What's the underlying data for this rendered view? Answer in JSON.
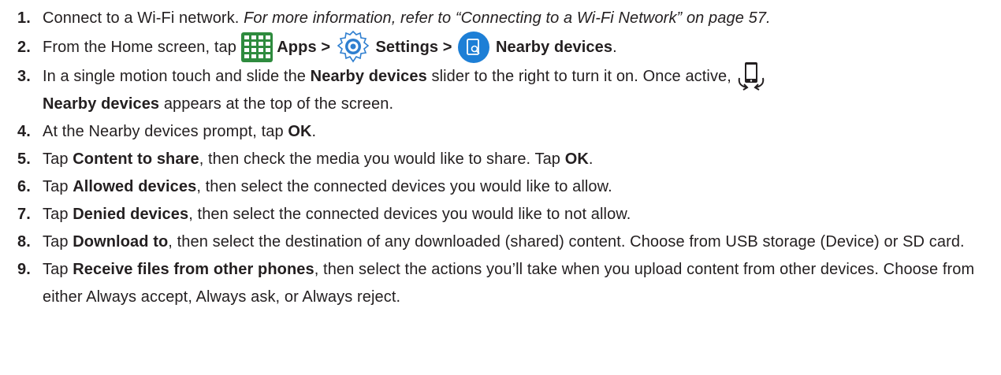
{
  "steps": [
    {
      "num": "1.",
      "text": "Connect to a Wi-Fi network. ",
      "note": "For more information, refer to “Connecting to a Wi-Fi Network” on page 57."
    },
    {
      "num": "2.",
      "pre": "From the Home screen, tap ",
      "apps": "Apps >",
      "settings": "Settings >",
      "nearby": "Nearby devices",
      "end": "."
    },
    {
      "num": "3.",
      "pre": "In a single motion touch and slide the ",
      "bold1": "Nearby devices",
      "mid": " slider to the right to turn it on. Once active,",
      "bold2": "Nearby devices",
      "post": " appears at the top of the screen."
    },
    {
      "num": "4.",
      "pre": "At the Nearby devices prompt, tap ",
      "bold": "OK",
      "post": "."
    },
    {
      "num": "5.",
      "pre": "Tap ",
      "bold": "Content to share",
      "mid": ", then check the media you would like to share. Tap ",
      "bold2": "OK",
      "post": "."
    },
    {
      "num": "6.",
      "pre": "Tap ",
      "bold": "Allowed devices",
      "post": ", then select the connected devices you would like to allow."
    },
    {
      "num": "7.",
      "pre": "Tap ",
      "bold": "Denied devices",
      "post": ", then select the connected devices you would like to not allow."
    },
    {
      "num": "8.",
      "pre": "Tap ",
      "bold": "Download to",
      "post": ", then select the destination of any downloaded (shared) content. Choose from USB storage (Device) or SD card."
    },
    {
      "num": "9.",
      "pre": "Tap ",
      "bold": "Receive files from other phones",
      "post": ", then select the actions you’ll take when you upload content from other devices. Choose from either Always accept, Always ask, or Always reject."
    }
  ],
  "icons": {
    "apps": "apps-grid-icon",
    "settings": "settings-gear-icon",
    "nearby": "nearby-devices-icon",
    "status": "nearby-devices-status-icon"
  },
  "colors": {
    "text": "#231f20",
    "apps_green": "#2e8b3e",
    "settings_blue": "#2f7fd0",
    "nearby_blue": "#1d7fd6"
  }
}
